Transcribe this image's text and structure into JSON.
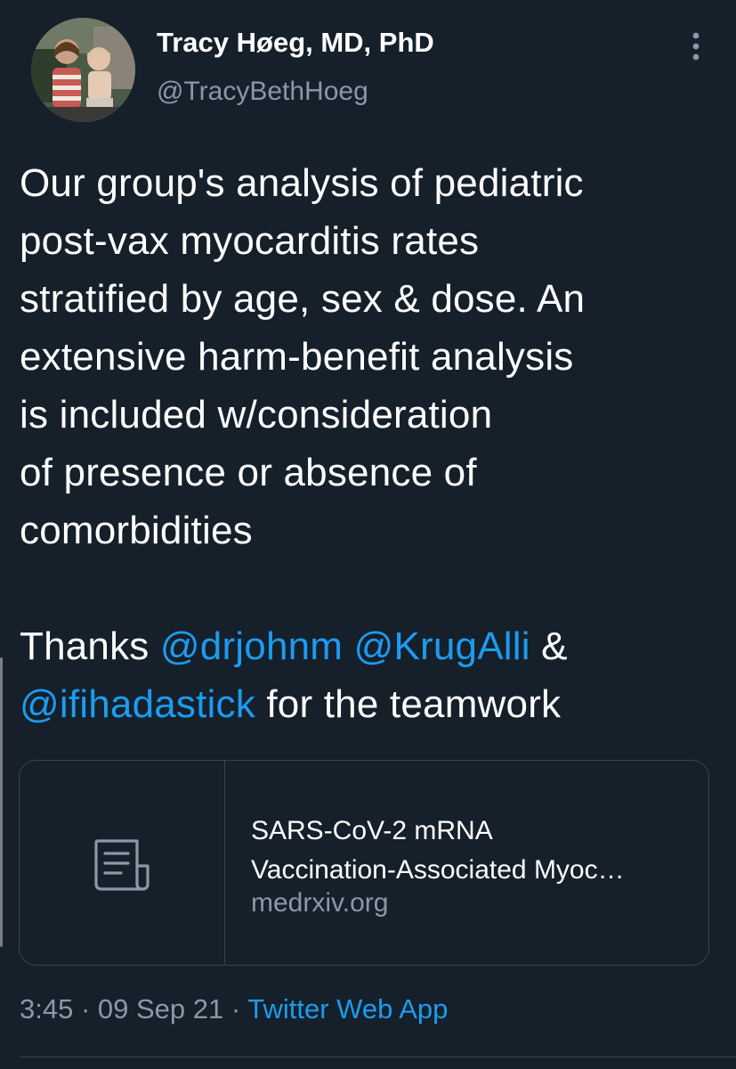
{
  "author": {
    "display_name": "Tracy Høeg, MD, PhD",
    "handle": "@TracyBethHoeg"
  },
  "tweet": {
    "line1": "Our group's analysis of pediatric",
    "line2": "post-vax myocarditis rates",
    "line3": "stratified by age, sex & dose. An",
    "line4": "extensive harm-benefit analysis",
    "line5": "is included w/consideration",
    "line6": "of presence or absence of",
    "line7": "comorbidities",
    "thanks_prefix": "Thanks ",
    "mention1": "@drjohnm",
    "mention2": "@KrugAlli",
    "amp": " &",
    "mention3": "@ifihadastick",
    "thanks_suffix": " for the teamwork"
  },
  "card": {
    "title_line1": "SARS-CoV-2 mRNA",
    "title_line2": "Vaccination-Associated Myoc…",
    "domain": "medrxiv.org",
    "icon": "document-icon"
  },
  "meta": {
    "time": "3:45",
    "separator1": " · ",
    "date": "09 Sep 21",
    "separator2": " · ",
    "source": "Twitter Web App"
  },
  "colors": {
    "background": "#15202b",
    "accent": "#1d9bf0",
    "secondary_text": "#8b98a5",
    "border": "#38444d"
  },
  "icons": {
    "more": "more-vertical-icon"
  }
}
